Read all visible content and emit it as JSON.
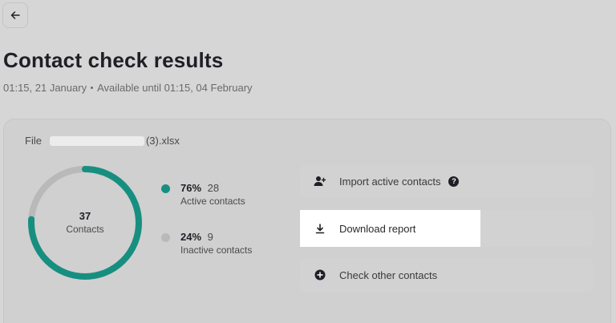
{
  "header": {
    "title": "Contact check results",
    "created": "01:15, 21 January",
    "available_until": "Available until 01:15, 04 February"
  },
  "file": {
    "label": "File",
    "name_suffix": "(3).xlsx"
  },
  "summary": {
    "total": "37",
    "total_caption": "Contacts",
    "active": {
      "percent": "76%",
      "count": "28",
      "label": "Active contacts",
      "color": "#178f80",
      "fraction": 0.76
    },
    "inactive": {
      "percent": "24%",
      "count": "9",
      "label": "Inactive contacts",
      "color": "#b9b9b9",
      "fraction": 0.24
    }
  },
  "actions": {
    "import_label": "Import active contacts",
    "download_label": "Download report",
    "check_label": "Check other contacts"
  },
  "icons": {
    "back": "arrow-left-icon",
    "import": "user-plus-icon",
    "help": "question-circle-icon",
    "download": "download-icon",
    "check": "plus-circle-icon"
  }
}
